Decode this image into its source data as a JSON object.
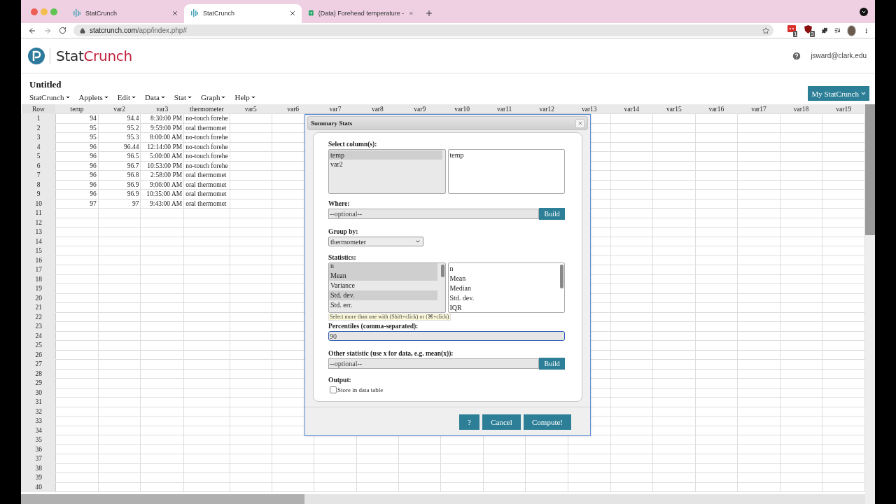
{
  "browser": {
    "tabs": [
      {
        "kind": "statcrunch",
        "title": "StatCrunch",
        "selected": false
      },
      {
        "kind": "statcrunch",
        "title": "StatCrunch",
        "selected": true
      },
      {
        "kind": "sheets",
        "title": "(Data) Forehead temperature -",
        "selected": false
      }
    ],
    "url_host": "statcrunch.com",
    "url_path": "/app/index.php#",
    "extension_badges": [
      "1",
      "3"
    ]
  },
  "app": {
    "logo_dark": "Stat",
    "logo_accent": "Crunch",
    "user": "jsward@clark.edu",
    "document_title": "Untitled",
    "menu": [
      "StatCrunch",
      "Applets",
      "Edit",
      "Data",
      "Stat",
      "Graph",
      "Help"
    ],
    "account_button": "My StatCrunch"
  },
  "grid": {
    "columns": [
      {
        "label": "Row",
        "kind": "index"
      },
      {
        "label": "temp",
        "kind": "numeric"
      },
      {
        "label": "var2",
        "kind": "numeric"
      },
      {
        "label": "var3",
        "kind": "numeric"
      },
      {
        "label": "thermometer",
        "kind": "text"
      },
      {
        "label": "var5"
      },
      {
        "label": "var6"
      },
      {
        "label": "var7"
      },
      {
        "label": "var8"
      },
      {
        "label": "var9"
      },
      {
        "label": "var10"
      },
      {
        "label": "var11"
      },
      {
        "label": "var12"
      },
      {
        "label": "var13"
      },
      {
        "label": "var14"
      },
      {
        "label": "var15"
      },
      {
        "label": "var16"
      },
      {
        "label": "var17"
      },
      {
        "label": "var18"
      },
      {
        "label": "var19"
      }
    ],
    "rows": [
      {
        "number": "1",
        "cells": [
          "94",
          "94.4",
          "8:30:00 PM",
          "no-touch forehe"
        ]
      },
      {
        "number": "2",
        "cells": [
          "95",
          "95.2",
          "9:59:00 PM",
          "oral thermomet"
        ]
      },
      {
        "number": "3",
        "cells": [
          "95",
          "95.3",
          "8:00:00 AM",
          "no-touch forehe"
        ]
      },
      {
        "number": "4",
        "cells": [
          "96",
          "96.44",
          "12:14:00 PM",
          "no-touch forehe"
        ]
      },
      {
        "number": "5",
        "cells": [
          "96",
          "96.5",
          "5:00:00 AM",
          "no-touch forehe"
        ]
      },
      {
        "number": "6",
        "cells": [
          "96",
          "96.7",
          "10:53:00 PM",
          "no-touch forehe"
        ]
      },
      {
        "number": "7",
        "cells": [
          "96",
          "96.8",
          "2:58:00 PM",
          "oral thermomet"
        ]
      },
      {
        "number": "8",
        "cells": [
          "96",
          "96.9",
          "9:06:00 AM",
          "oral thermomet"
        ]
      },
      {
        "number": "9",
        "cells": [
          "96",
          "96.9",
          "10:35:00 AM",
          "oral thermomet"
        ]
      },
      {
        "number": "10",
        "cells": [
          "97",
          "97",
          "9:43:00 AM",
          "oral thermomet"
        ]
      },
      {
        "number": "11"
      },
      {
        "number": "12"
      },
      {
        "number": "13"
      },
      {
        "number": "14"
      },
      {
        "number": "15"
      },
      {
        "number": "16"
      },
      {
        "number": "17"
      },
      {
        "number": "18"
      },
      {
        "number": "19"
      },
      {
        "number": "20"
      },
      {
        "number": "21"
      },
      {
        "number": "22"
      },
      {
        "number": "23"
      },
      {
        "number": "24"
      },
      {
        "number": "25"
      },
      {
        "number": "26"
      },
      {
        "number": "27"
      },
      {
        "number": "28"
      },
      {
        "number": "29"
      },
      {
        "number": "30"
      },
      {
        "number": "31"
      },
      {
        "number": "32"
      },
      {
        "number": "33"
      },
      {
        "number": "34"
      },
      {
        "number": "35"
      },
      {
        "number": "36"
      },
      {
        "number": "37"
      },
      {
        "number": "38"
      },
      {
        "number": "39"
      },
      {
        "number": "40"
      }
    ]
  },
  "dialog": {
    "title": "Summary Stats",
    "columns_label": "Select column(s):",
    "columns_available": [
      {
        "label": "temp",
        "selected": true
      },
      {
        "label": "var2",
        "selected": false
      }
    ],
    "columns_chosen": [
      "temp"
    ],
    "where_label": "Where:",
    "where_placeholder": "--optional--",
    "where_build": "Build",
    "group_label": "Group by:",
    "group_value": "thermometer",
    "statistics_label": "Statistics:",
    "statistics_available": [
      {
        "label": "n",
        "selected": true
      },
      {
        "label": "Mean",
        "selected": true
      },
      {
        "label": "Variance",
        "selected": false
      },
      {
        "label": "Std. dev.",
        "selected": true
      },
      {
        "label": "Std. err.",
        "selected": false
      }
    ],
    "statistics_chosen": [
      "n",
      "Mean",
      "Median",
      "Std. dev.",
      "IQR"
    ],
    "hint": "Select more than one with (Shift+click) or (⌘+click)",
    "percentiles_label": "Percentiles (comma-separated):",
    "percentiles_value": "90",
    "other_label": "Other statistic (use x for data, e.g. mean(x)):",
    "other_placeholder": "--optional--",
    "other_build": "Build",
    "output_label": "Output:",
    "store": {
      "label": "Store in data table",
      "checked": false
    },
    "buttons": [
      "?",
      "Cancel",
      "Compute!"
    ]
  }
}
